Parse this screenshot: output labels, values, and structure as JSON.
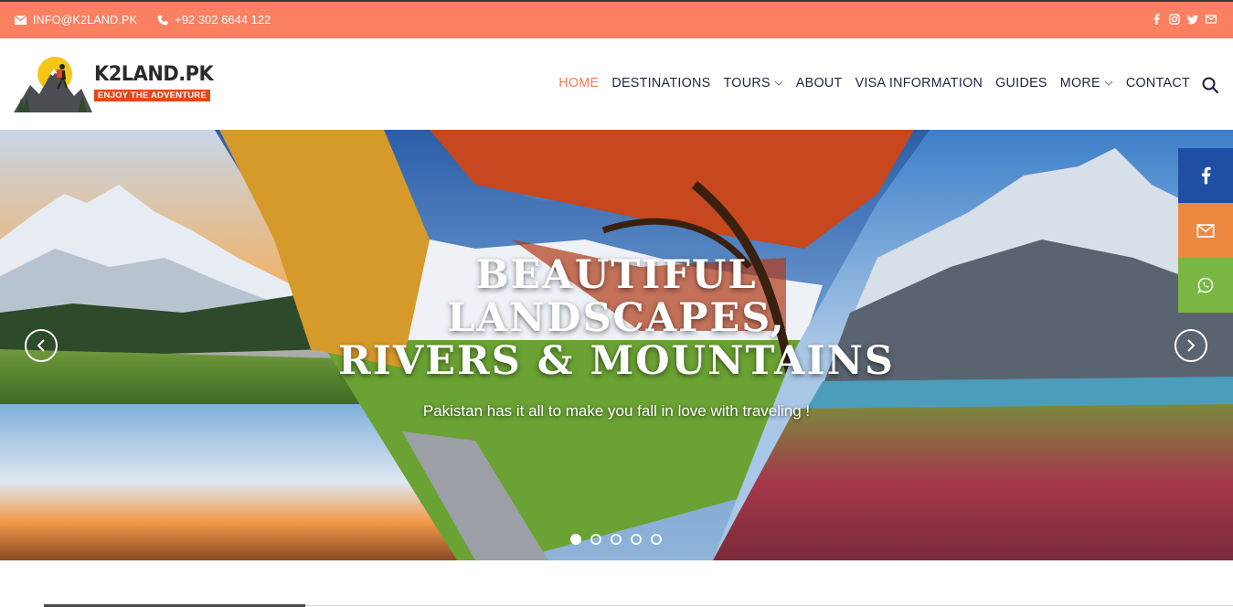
{
  "topbar": {
    "email": "INFO@K2LAND.PK",
    "phone": "+92 302 6644 122",
    "social_icons": [
      "facebook-icon",
      "instagram-icon",
      "twitter-icon",
      "envelope-icon"
    ]
  },
  "logo": {
    "title": "K2LAND.PK",
    "tagline": "ENJOY THE ADVENTURE"
  },
  "nav": {
    "items": [
      {
        "label": "HOME",
        "active": true
      },
      {
        "label": "DESTINATIONS"
      },
      {
        "label": "TOURS",
        "dropdown": true
      },
      {
        "label": "ABOUT"
      },
      {
        "label": "VISA INFORMATION"
      },
      {
        "label": "GUIDES"
      },
      {
        "label": "MORE",
        "dropdown": true
      },
      {
        "label": "CONTACT"
      }
    ]
  },
  "hero": {
    "title_line1": "BEAUTIFUL",
    "title_line2": "LANDSCAPES,",
    "title_line3": "RIVERS & MOUNTAINS",
    "subtitle": "Pakistan has it all to make you fall in love with traveling !",
    "slide_count": 5,
    "active_slide": 1
  },
  "share": {
    "buttons": [
      "facebook-icon",
      "envelope-icon",
      "whatsapp-icon"
    ]
  },
  "colors": {
    "topbar": "#fb8061",
    "accent": "#fb7a54",
    "nav_text": "#1c2440",
    "facebook": "#1e4fa3",
    "mail": "#ee873f",
    "whatsapp": "#7ab742"
  }
}
